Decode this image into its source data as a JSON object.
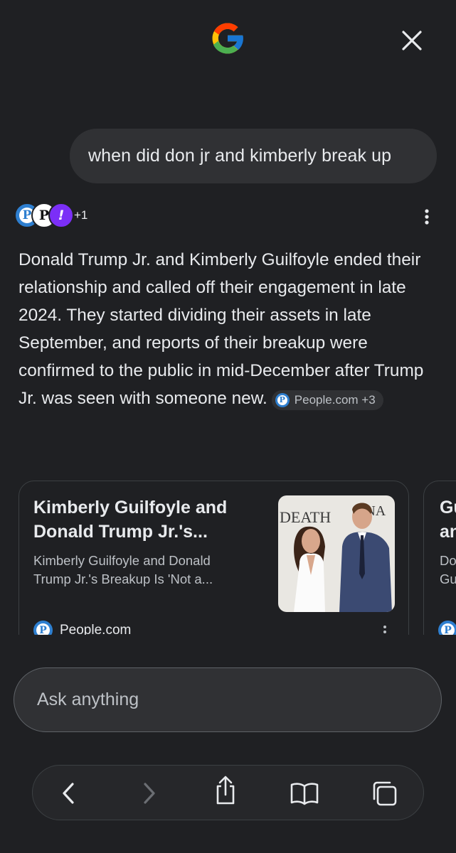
{
  "header": {
    "logo_icon": "google-g-icon",
    "close_icon": "close-icon"
  },
  "query": {
    "text": "when did don jr and kimberly break up"
  },
  "sources": {
    "avatars": [
      "P",
      "P",
      "!"
    ],
    "more_count": "+1",
    "menu_icon": "more-vert-icon"
  },
  "answer": {
    "text": "Donald Trump Jr. and Kimberly Guilfoyle ended their relationship and called off their engagement in late 2024. They started dividing their assets in late September, and reports of their breakup were confirmed to the public in mid-December after Trump Jr. was seen with someone new.",
    "source_chip": {
      "label": "People.com +3",
      "icon": "people-logo-icon"
    }
  },
  "cards": [
    {
      "title": "Kimberly Guilfoyle and Donald Trump Jr.'s...",
      "snippet": "Kimberly Guilfoyle and Donald Trump Jr.'s Breakup Is 'Not a...",
      "source": "People.com",
      "image_text": "DEATH",
      "image_text2": "A NA"
    },
    {
      "title_partial": "Gu\nan",
      "snippet_partial": "Do\nGu"
    }
  ],
  "input": {
    "placeholder": "Ask anything"
  },
  "toolbar": {
    "buttons": [
      "back-icon",
      "forward-icon",
      "share-icon",
      "bookmarks-icon",
      "tabs-icon"
    ]
  },
  "colors": {
    "background": "#1f2023",
    "surface": "#303134",
    "text": "#e8eaed",
    "muted": "#bdc1c6",
    "people_blue": "#2e7fd0",
    "yahoo_purple": "#7b2ff7"
  }
}
